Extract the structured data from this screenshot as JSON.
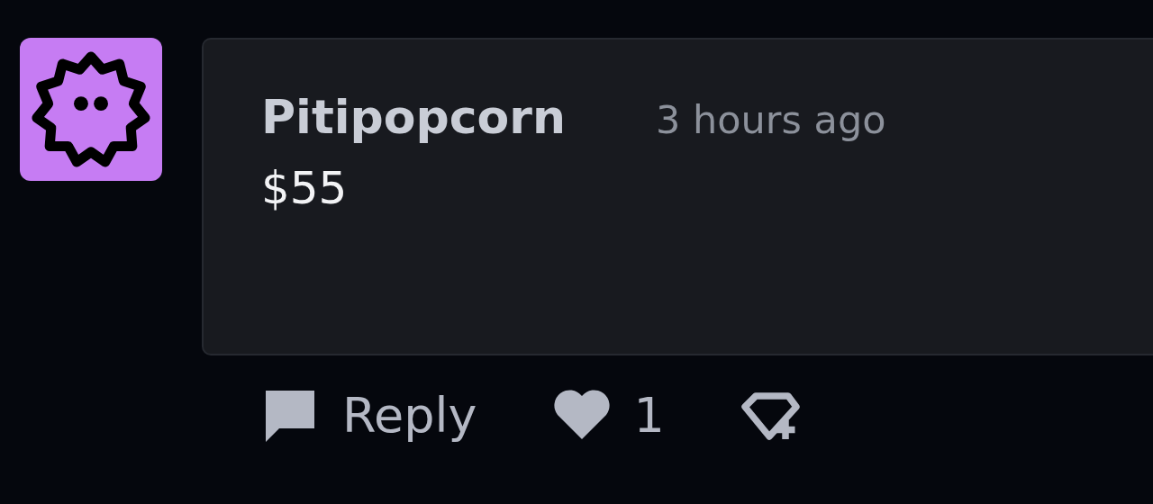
{
  "comment": {
    "author": "Pitipopcorn",
    "time": "3 hours ago",
    "body": "$55"
  },
  "actions": {
    "reply": "Reply",
    "likes": "1"
  }
}
